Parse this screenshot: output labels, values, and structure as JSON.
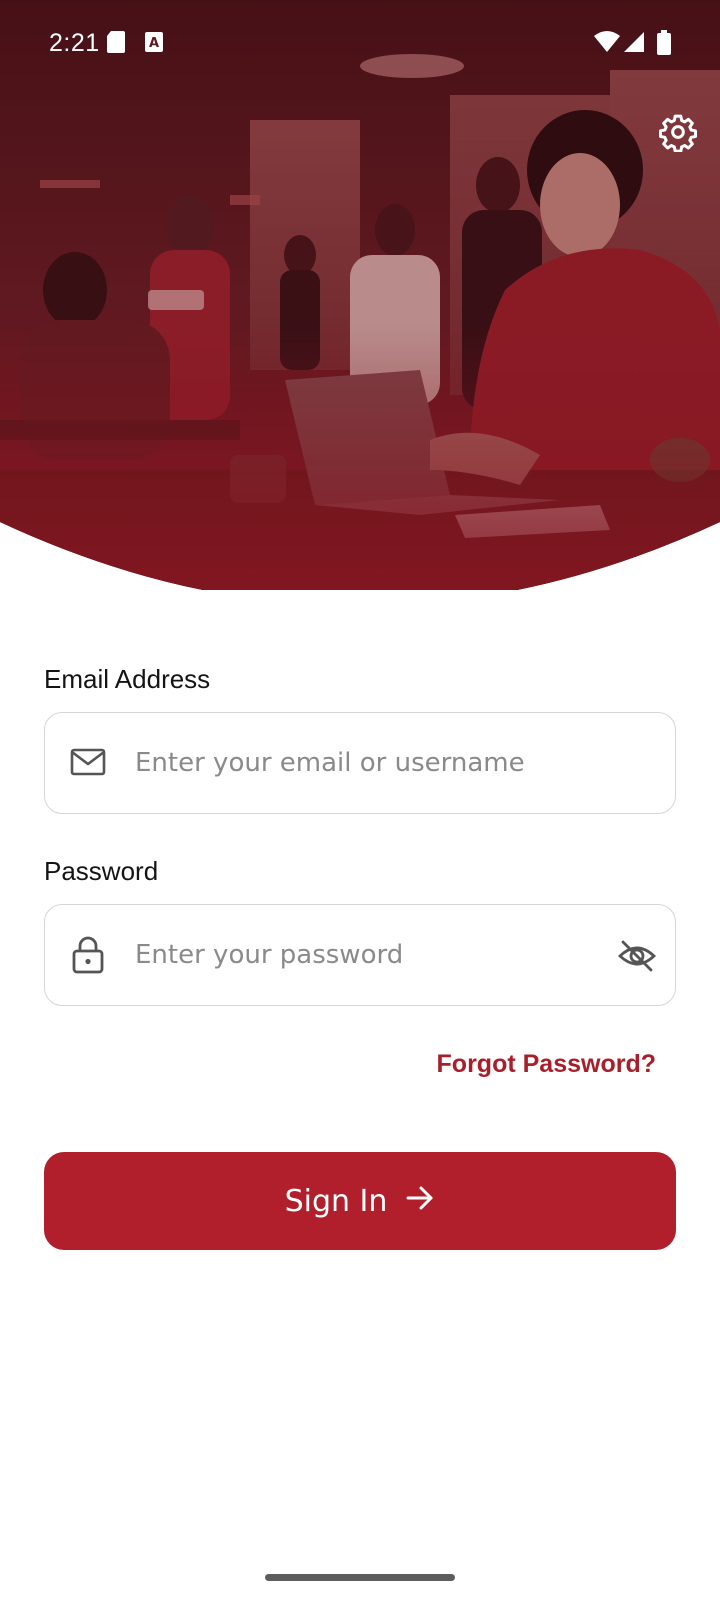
{
  "status_bar": {
    "time": "2:21",
    "icons": [
      "sd-card-icon",
      "text-a-icon",
      "wifi-icon",
      "signal-icon",
      "battery-icon"
    ]
  },
  "hero": {
    "description_icon": "office-photo",
    "tint_color": "#7a1420"
  },
  "settings": {
    "icon": "gear-icon"
  },
  "form": {
    "email": {
      "label": "Email Address",
      "placeholder": "Enter your email or username",
      "value": "",
      "icon": "mail-icon"
    },
    "password": {
      "label": "Password",
      "placeholder": "Enter your password",
      "value": "",
      "icon": "lock-icon",
      "toggle_icon": "eye-off-icon"
    },
    "forgot_password": "Forgot Password?",
    "sign_in": {
      "label": "Sign In",
      "icon": "arrow-right-icon"
    }
  },
  "colors": {
    "primary": "#b01f2b",
    "link": "#a91e2a",
    "border": "#d6d6d6"
  }
}
